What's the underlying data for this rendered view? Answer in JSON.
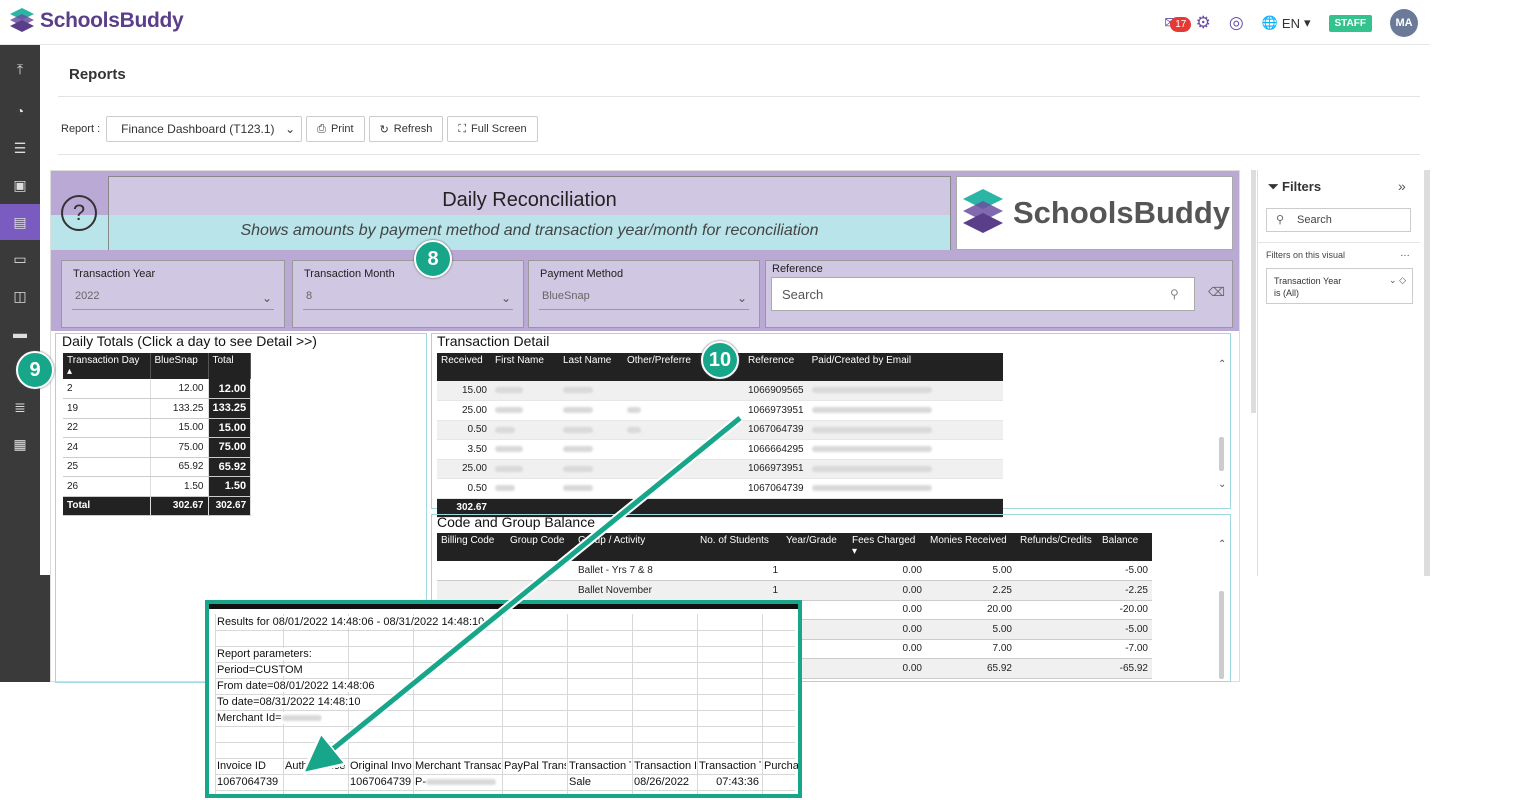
{
  "brand": {
    "name": "SchoolsBuddy",
    "accent": "#7a5bbf",
    "teal": "#17a68a"
  },
  "topbar": {
    "mail_count": "17",
    "language": "EN",
    "staff_badge": "STAFF",
    "avatar_initials": "MA"
  },
  "page": {
    "title": "Reports"
  },
  "toolbar": {
    "report_label": "Report :",
    "report_selected": "Finance Dashboard (T123.1)",
    "print_label": "Print",
    "refresh_label": "Refresh",
    "fullscreen_label": "Full Screen"
  },
  "report": {
    "title": "Daily Reconciliation",
    "subtitle": "Shows amounts by payment method and transaction year/month for reconciliation",
    "logo_text": "SchoolsBuddy",
    "slicers": {
      "year": {
        "label": "Transaction Year",
        "value": "2022"
      },
      "month": {
        "label": "Transaction Month",
        "value": "8"
      },
      "method": {
        "label": "Payment Method",
        "value": "BlueSnap"
      }
    },
    "reference": {
      "label": "Reference",
      "placeholder": "Search"
    },
    "daily_totals": {
      "title": "Daily Totals (Click a day to see Detail >>)",
      "headers": [
        "Transaction Day",
        "BlueSnap",
        "Total"
      ],
      "rows": [
        {
          "day": "2",
          "bluesnap": "12.00",
          "total": "12.00"
        },
        {
          "day": "19",
          "bluesnap": "133.25",
          "total": "133.25"
        },
        {
          "day": "22",
          "bluesnap": "15.00",
          "total": "15.00"
        },
        {
          "day": "24",
          "bluesnap": "75.00",
          "total": "75.00"
        },
        {
          "day": "25",
          "bluesnap": "65.92",
          "total": "65.92"
        },
        {
          "day": "26",
          "bluesnap": "1.50",
          "total": "1.50"
        }
      ],
      "total_row": {
        "label": "Total",
        "bluesnap": "302.67",
        "total": "302.67"
      }
    },
    "transaction_detail": {
      "title": "Transaction Detail",
      "headers": [
        "Received",
        "First Name",
        "Last Name",
        "Other/Preferre",
        "Reference",
        "Paid/Created by Email"
      ],
      "rows": [
        {
          "received": "15.00",
          "reference": "1066909565"
        },
        {
          "received": "25.00",
          "reference": "1066973951"
        },
        {
          "received": "0.50",
          "reference": "1067064739"
        },
        {
          "received": "3.50",
          "reference": "1066664295"
        },
        {
          "received": "25.00",
          "reference": "1066973951"
        },
        {
          "received": "0.50",
          "reference": "1067064739"
        }
      ],
      "total": "302.67"
    },
    "code_group": {
      "title": "Code and Group Balance",
      "headers": [
        "Billing Code",
        "Group Code",
        "Group / Activity",
        "No. of Students",
        "Year/Grade",
        "Fees Charged",
        "Monies Received",
        "Refunds/Credits",
        "Balance"
      ],
      "rows": [
        {
          "activity": "Ballet - Yrs 7 & 8",
          "students": "1",
          "fees": "0.00",
          "monies": "5.00",
          "balance": "-5.00"
        },
        {
          "activity": "Ballet November",
          "students": "1",
          "fees": "0.00",
          "monies": "2.25",
          "balance": "-2.25"
        },
        {
          "activity": "",
          "students": "1",
          "fees": "0.00",
          "monies": "20.00",
          "balance": "-20.00"
        },
        {
          "activity": "",
          "students": "",
          "fees": "0.00",
          "monies": "5.00",
          "balance": "-5.00"
        },
        {
          "activity": "",
          "students": "",
          "fees": "0.00",
          "monies": "7.00",
          "balance": "-7.00"
        },
        {
          "activity": "",
          "students": "",
          "fees": "0.00",
          "monies": "65.92",
          "balance": "-65.92"
        }
      ]
    }
  },
  "filters": {
    "title": "Filters",
    "search_placeholder": "Search",
    "section_label": "Filters on this visual",
    "card_line1": "Transaction Year",
    "card_line2": "is (All)"
  },
  "callouts": {
    "c8": "8",
    "c9": "9",
    "c10": "10"
  },
  "excel": {
    "line1": "Results for 08/01/2022 14:48:06 - 08/31/2022 14:48:10",
    "line2": "Report parameters:",
    "line3": "Period=CUSTOM",
    "line4": "From date=08/01/2022 14:48:06",
    "line5": "To date=08/31/2022 14:48:10",
    "line6": "Merchant Id=",
    "headers": [
      "Invoice ID",
      "Auth Invoice",
      "Original Invo",
      "Merchant Transac",
      "PayPal Trans",
      "Transaction T",
      "Transaction D",
      "Transaction T",
      "Purchas"
    ],
    "row": [
      "1067064739",
      "",
      "1067064739",
      "P-",
      "",
      "Sale",
      "08/26/2022",
      "07:43:36",
      ""
    ]
  }
}
